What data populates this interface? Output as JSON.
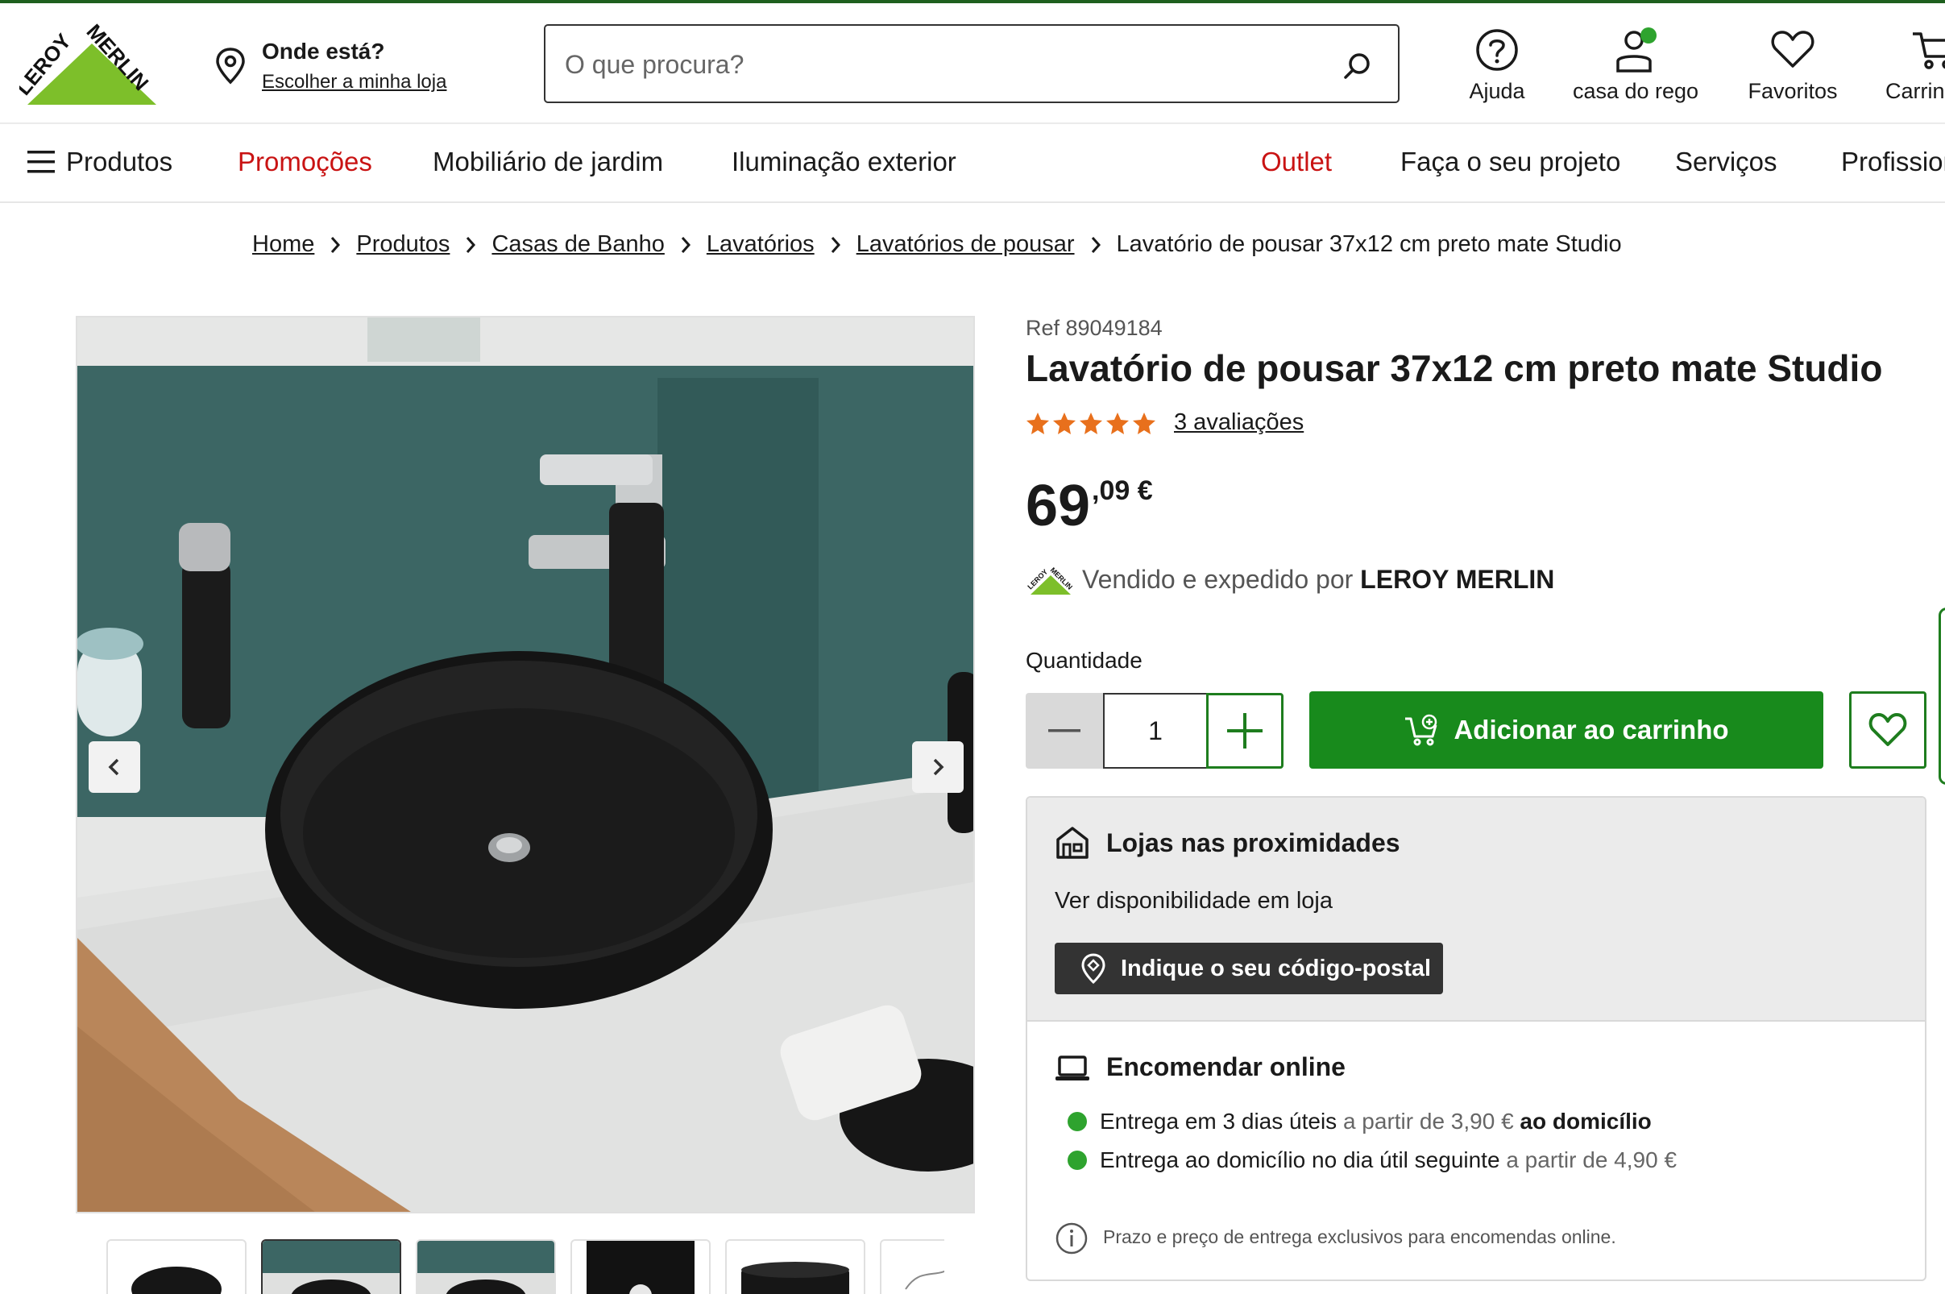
{
  "header": {
    "location_title": "Onde está?",
    "location_link": "Escolher a minha loja",
    "search_placeholder": "O que procura?",
    "tools": [
      {
        "label": "Ajuda",
        "icon": "help-icon"
      },
      {
        "label": "casa do rego",
        "icon": "user-icon"
      },
      {
        "label": "Favoritos",
        "icon": "heart-icon"
      },
      {
        "label": "Carrinho",
        "icon": "cart-icon"
      }
    ]
  },
  "nav": {
    "menu_label": "Produtos",
    "items": [
      "Promoções",
      "Mobiliário de jardim",
      "Iluminação exterior",
      "Outlet",
      "Faça o seu projeto",
      "Serviços",
      "Profissionais"
    ]
  },
  "breadcrumb": [
    "Home",
    "Produtos",
    "Casas de Banho",
    "Lavatórios",
    "Lavatórios de pousar",
    "Lavatório de pousar 37x12 cm preto mate Studio"
  ],
  "product": {
    "ref": "Ref 89049184",
    "title": "Lavatório de pousar 37x12 cm preto mate Studio",
    "rating": 5,
    "reviews": "3 avaliações",
    "price_int": "69",
    "price_dec": ",09 €",
    "seller_prefix": "Vendido e expedido por ",
    "seller_name": "LEROY MERLIN",
    "quantity_label": "Quantidade",
    "quantity": "1",
    "add_to_cart": "Adicionar ao carrinho"
  },
  "availability": {
    "store_title": "Lojas nas proximidades",
    "store_text": "Ver disponibilidade em loja",
    "postcode_button": "Indique o seu código-postal",
    "online_title": "Encomendar online",
    "delivery1": {
      "main": "Entrega em 3 dias úteis",
      "muted": " a partir de 3,90 €",
      "bold": " ao domicílio"
    },
    "delivery2": {
      "main": "Entrega ao domicílio no dia útil seguinte",
      "muted": " a partir de 4,90 €"
    },
    "info": "Prazo e preço de entrega exclusivos para encomendas online."
  },
  "colors": {
    "brand_green": "#188a1c",
    "promo_red": "#c91313",
    "star_orange": "#e8701c",
    "status_green": "#2ea32e"
  }
}
